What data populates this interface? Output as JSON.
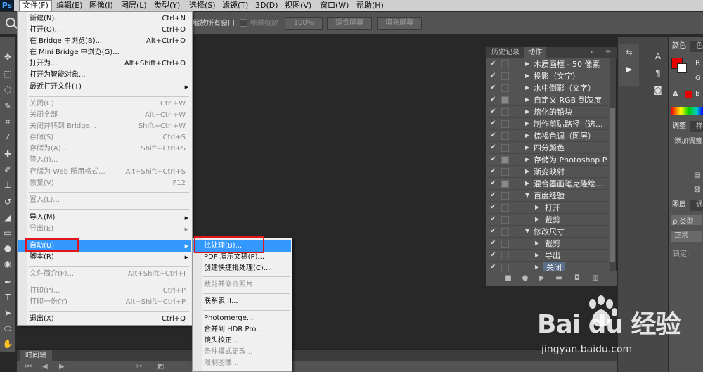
{
  "app": {
    "logo": "Ps"
  },
  "menubar": {
    "items": [
      {
        "label": "文件(F)",
        "active": true
      },
      {
        "label": "编辑(E)"
      },
      {
        "label": "图像(I)"
      },
      {
        "label": "图层(L)"
      },
      {
        "label": "类型(Y)"
      },
      {
        "label": "选择(S)"
      },
      {
        "label": "滤镜(T)"
      },
      {
        "label": "3D(D)"
      },
      {
        "label": "视图(V)"
      },
      {
        "label": "窗口(W)"
      },
      {
        "label": "帮助(H)"
      }
    ]
  },
  "options": {
    "resize_all_windows": "缩放所有窗口",
    "scrubby_zoom": "细微缩放",
    "zoom_100": "100%",
    "fit_screen": "适合屏幕",
    "fill_screen": "填充屏幕"
  },
  "file_menu": {
    "items": [
      {
        "label": "新建(N)...",
        "shortcut": "Ctrl+N"
      },
      {
        "label": "打开(O)...",
        "shortcut": "Ctrl+O"
      },
      {
        "label": "在 Bridge 中浏览(B)...",
        "shortcut": "Alt+Ctrl+O"
      },
      {
        "label": "在 Mini Bridge 中浏览(G)...",
        "shortcut": ""
      },
      {
        "label": "打开为...",
        "shortcut": "Alt+Shift+Ctrl+O"
      },
      {
        "label": "打开为智能对象...",
        "shortcut": ""
      },
      {
        "label": "最近打开文件(T)",
        "shortcut": ""
      },
      {
        "label": "关闭(C)",
        "shortcut": "Ctrl+W"
      },
      {
        "label": "关闭全部",
        "shortcut": "Alt+Ctrl+W"
      },
      {
        "label": "关闭并转到 Bridge...",
        "shortcut": "Shift+Ctrl+W"
      },
      {
        "label": "存储(S)",
        "shortcut": "Ctrl+S"
      },
      {
        "label": "存储为(A)...",
        "shortcut": "Shift+Ctrl+S"
      },
      {
        "label": "签入(I)...",
        "shortcut": ""
      },
      {
        "label": "存储为 Web 所用格式...",
        "shortcut": "Alt+Shift+Ctrl+S"
      },
      {
        "label": "恢复(V)",
        "shortcut": "F12"
      },
      {
        "label": "置入(L)...",
        "shortcut": ""
      },
      {
        "label": "导入(M)",
        "shortcut": ""
      },
      {
        "label": "导出(E)",
        "shortcut": ""
      },
      {
        "label": "自动(U)",
        "shortcut": ""
      },
      {
        "label": "脚本(R)",
        "shortcut": ""
      },
      {
        "label": "文件简介(F)...",
        "shortcut": "Alt+Shift+Ctrl+I"
      },
      {
        "label": "打印(P)...",
        "shortcut": "Ctrl+P"
      },
      {
        "label": "打印一份(Y)",
        "shortcut": "Alt+Shift+Ctrl+P"
      },
      {
        "label": "退出(X)",
        "shortcut": "Ctrl+Q"
      }
    ]
  },
  "automate_menu": {
    "items": [
      {
        "label": "批处理(B)..."
      },
      {
        "label": "PDF 演示文稿(P)..."
      },
      {
        "label": "创建快捷批处理(C)..."
      },
      {
        "label": "裁剪并修齐照片"
      },
      {
        "label": "联系表 II..."
      },
      {
        "label": "Photomerge..."
      },
      {
        "label": "合并到 HDR Pro..."
      },
      {
        "label": "镜头校正..."
      },
      {
        "label": "条件模式更改..."
      },
      {
        "label": "限制图像..."
      }
    ]
  },
  "actions_panel": {
    "tabs": [
      "历史记录",
      "动作"
    ],
    "rows": [
      {
        "label": "木质画框 - 50 像素"
      },
      {
        "label": "投影（文字）"
      },
      {
        "label": "水中倒影（文字）"
      },
      {
        "label": "自定义 RGB 到灰度"
      },
      {
        "label": "熔化的铅块"
      },
      {
        "label": "制作剪贴路径（选..."
      },
      {
        "label": "棕褐色调（图层）"
      },
      {
        "label": "四分颜色"
      },
      {
        "label": "存储为 Photoshop P..."
      },
      {
        "label": "渐变映射"
      },
      {
        "label": "混合器画笔克隆绘..."
      },
      {
        "label": "百度经验"
      },
      {
        "label": "打开"
      },
      {
        "label": "裁剪"
      },
      {
        "label": "修改尺寸"
      },
      {
        "label": "裁剪"
      },
      {
        "label": "导出"
      },
      {
        "label": "关闭"
      }
    ]
  },
  "right_panels": {
    "color_tabs": [
      "颜色",
      "色"
    ],
    "channel_r": "R",
    "channel_g": "G",
    "channel_b": "B",
    "adjust_tabs": [
      "调整",
      "样"
    ],
    "adjust_title": "添加调整",
    "layers_tabs": [
      "图层",
      "通"
    ],
    "layer_kind": "ρ 类型",
    "blend_mode": "正常",
    "lock_label": "锁定:",
    "fg_color": "#e60000"
  },
  "timeline": {
    "tab": "时间轴"
  },
  "watermark": {
    "brand": "Bai du 经验",
    "url": "jingyan.baidu.com"
  }
}
